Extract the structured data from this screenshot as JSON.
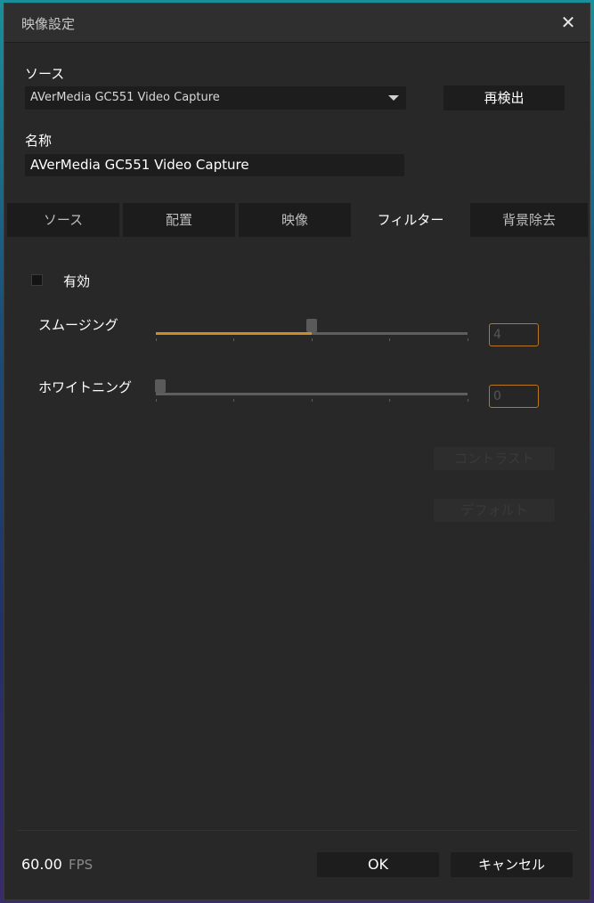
{
  "dialog": {
    "title": "映像設定",
    "close_symbol": "✕"
  },
  "source": {
    "label": "ソース",
    "selected": "AVerMedia GC551 Video Capture",
    "rescan_label": "再検出"
  },
  "name": {
    "label": "名称",
    "value": "AVerMedia GC551 Video Capture"
  },
  "tabs": [
    {
      "label": "ソース"
    },
    {
      "label": "配置"
    },
    {
      "label": "映像"
    },
    {
      "label": "フィルター",
      "active": true
    },
    {
      "label": "背景除去"
    }
  ],
  "filter": {
    "enabled_label": "有効",
    "enabled": false,
    "smoothing": {
      "label": "スムージング",
      "value": "4",
      "level_fraction": 0.5
    },
    "whitening": {
      "label": "ホワイトニング",
      "value": "0",
      "level_fraction": 0.0
    },
    "contrast_label": "コントラスト",
    "default_label": "デフォルト"
  },
  "footer": {
    "fps_value": "60.00",
    "fps_unit": "FPS",
    "ok_label": "OK",
    "cancel_label": "キャンセル"
  },
  "colors": {
    "accent": "#d08a2a",
    "background": "#282828"
  }
}
